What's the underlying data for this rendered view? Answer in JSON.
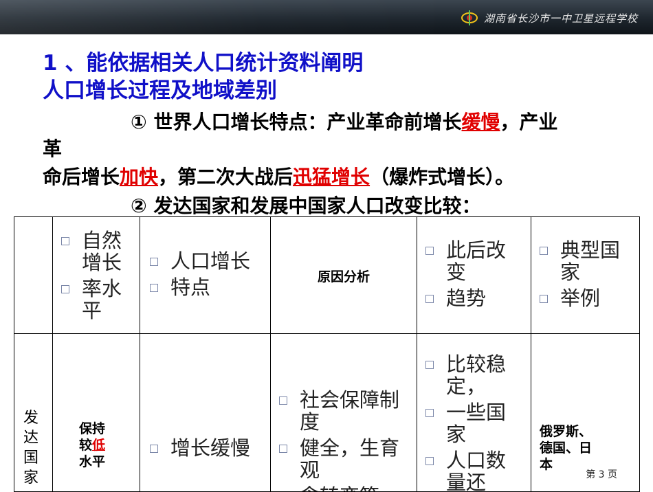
{
  "header": {
    "school_name": "湖南省长沙市一中卫星远程学校",
    "logo_icon": "school-logo-icon"
  },
  "heading": {
    "line1": "1 、能依据相关人口统计资料阐明",
    "line2": "人口增长过程及地域差别"
  },
  "body": {
    "p1_a": "① 世界人口增长特点：产业革命前增长",
    "p1_red1": "缓慢",
    "p1_b": "，产业",
    "p1_wrap": "革",
    "p2_a": "命后增长",
    "p2_red1": "加快",
    "p2_b": "，第二次大战后",
    "p2_red2": "迅猛增长",
    "p2_c": "（爆炸式增长）。",
    "p3": "② 发达国家和发展中国家人口改变比较："
  },
  "table": {
    "header": {
      "col2": [
        "自然增长",
        "率水平"
      ],
      "col3": [
        "人口增长",
        "特点"
      ],
      "col4": "原因分析",
      "col5": [
        "此后改变",
        "趋势"
      ],
      "col6": [
        "典型国家",
        "举例"
      ]
    },
    "row1": {
      "col1": "发达国家",
      "col2_a": "保持",
      "col2_b": "较",
      "col2_red": "低",
      "col2_c": "水平",
      "col3": [
        "增长缓慢"
      ],
      "col4": [
        "社会保障制度",
        "健全，生育观",
        "念转变等"
      ],
      "col5": [
        "比较稳定，",
        "一些国家",
        "人口数量还"
      ],
      "col6": "俄罗斯、德国、日本"
    }
  },
  "footer": {
    "page_label": "第 3 页"
  },
  "colors": {
    "heading": "#1010c8",
    "highlight": "#e00000",
    "bullet_box": "#7a86a8",
    "topbar": "#1e262e"
  }
}
